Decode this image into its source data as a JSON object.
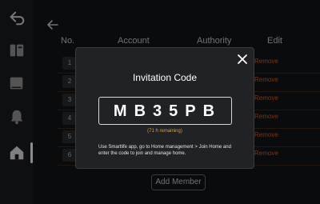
{
  "table": {
    "headers": {
      "no": "No.",
      "account": "Account",
      "authority": "Authority",
      "edit": "Edit"
    },
    "rows": [
      {
        "no": "1",
        "account": "",
        "authority": "",
        "edit": "Remove"
      },
      {
        "no": "2",
        "account": "",
        "authority": "",
        "edit": "Remove"
      },
      {
        "no": "3",
        "account": "",
        "authority": "",
        "edit": "Remove"
      },
      {
        "no": "4",
        "account": "",
        "authority": "",
        "edit": "Remove"
      },
      {
        "no": "5",
        "account": "",
        "authority": "",
        "edit": "Remove"
      },
      {
        "no": "6",
        "account": "",
        "authority": "",
        "edit": "Remove"
      }
    ]
  },
  "add_member_label": "Add Member",
  "modal": {
    "title": "Invitation Code",
    "code": "MB35PB",
    "remaining": "(71 h remaining)",
    "instructions": "Use Smartlife app, go to Home management > Join Home and enter the code to join and manage home."
  },
  "colors": {
    "accent": "#d6622a",
    "remaining": "#e19a3b"
  }
}
